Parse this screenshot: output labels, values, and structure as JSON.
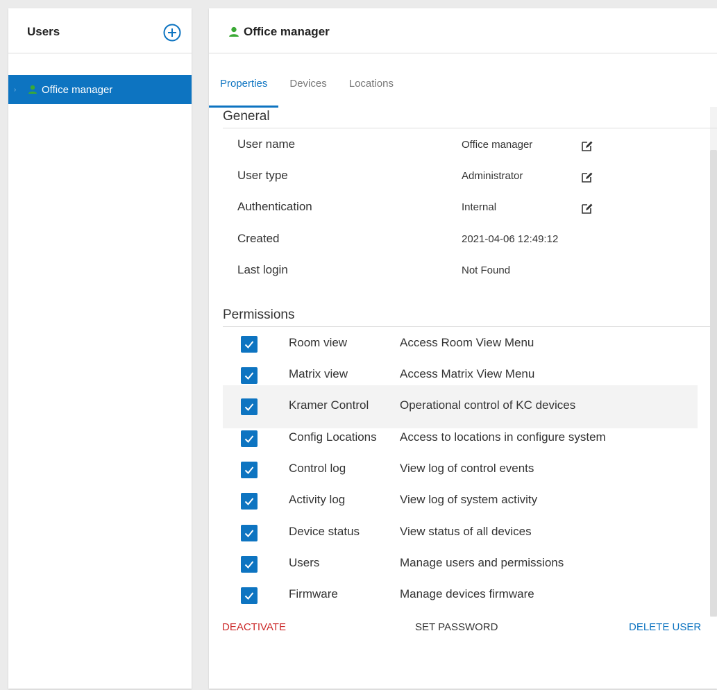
{
  "users_panel": {
    "title": "Users",
    "items": [
      {
        "label": "Office manager",
        "selected": true
      }
    ]
  },
  "detail": {
    "title": "Office manager",
    "tabs": [
      {
        "label": "Properties",
        "active": true
      },
      {
        "label": "Devices",
        "active": false
      },
      {
        "label": "Locations",
        "active": false
      }
    ],
    "general": {
      "heading": "General",
      "rows": [
        {
          "label": "User name",
          "value": "Office manager",
          "editable": true
        },
        {
          "label": "User type",
          "value": "Administrator",
          "editable": true
        },
        {
          "label": "Authentication",
          "value": "Internal",
          "editable": true
        },
        {
          "label": "Created",
          "value": "2021-04-06 12:49:12",
          "editable": false
        },
        {
          "label": "Last login",
          "value": "Not Found",
          "editable": false
        }
      ]
    },
    "permissions": {
      "heading": "Permissions",
      "rows": [
        {
          "name": "Room view",
          "description": "Access Room View Menu",
          "checked": true
        },
        {
          "name": "Matrix view",
          "description": "Access Matrix View Menu",
          "checked": true
        },
        {
          "name": "Kramer Control",
          "description": "Operational control of KC devices",
          "checked": true
        },
        {
          "name": "Config Locations",
          "description": "Access to locations in configure system",
          "checked": true
        },
        {
          "name": "Control log",
          "description": "View log of control events",
          "checked": true
        },
        {
          "name": "Activity log",
          "description": "View log of system activity",
          "checked": true
        },
        {
          "name": "Device status",
          "description": "View status of all devices",
          "checked": true
        },
        {
          "name": "Users",
          "description": "Manage users and permissions",
          "checked": true
        },
        {
          "name": "Firmware",
          "description": "Manage devices firmware",
          "checked": true
        }
      ]
    },
    "actions": {
      "deactivate": "DEACTIVATE",
      "set_password": "SET PASSWORD",
      "delete_user": "DELETE USER"
    }
  },
  "colors": {
    "accent": "#0d74c1",
    "user_icon": "#3aa935",
    "danger": "#cc2a2a"
  },
  "icons": {
    "add": "plus-circle-icon",
    "user": "person-icon",
    "edit": "edit-icon",
    "check": "check-icon"
  }
}
